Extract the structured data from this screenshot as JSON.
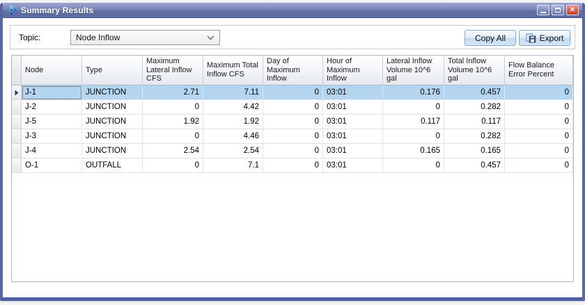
{
  "window": {
    "title": "Summary Results",
    "icons": {
      "app": "node-network-icon",
      "minimize": "–",
      "maximize": "□",
      "close": "✕"
    }
  },
  "toolbar": {
    "topic_label": "Topic:",
    "topic_value": "Node Inflow",
    "copy_all_label": "Copy All",
    "export_label": "Export",
    "icons": {
      "dropdown": "chevron-down",
      "export": "export-save"
    }
  },
  "grid": {
    "columns": [
      {
        "label": "Node",
        "align": "left"
      },
      {
        "label": "Type",
        "align": "left"
      },
      {
        "label": "Maximum Lateral Inflow CFS",
        "align": "right"
      },
      {
        "label": "Maximum Total Inflow CFS",
        "align": "right"
      },
      {
        "label": "Day of Maximum Inflow",
        "align": "right"
      },
      {
        "label": "Hour of Maximum Inflow",
        "align": "left"
      },
      {
        "label": "Lateral Inflow Volume 10^6 gal",
        "align": "right"
      },
      {
        "label": "Total Inflow Volume 10^6 gal",
        "align": "right"
      },
      {
        "label": "Flow Balance Error Percent",
        "align": "right"
      }
    ],
    "rows": [
      [
        "J-1",
        "JUNCTION",
        "2.71",
        "7.11",
        "0",
        "03:01",
        "0.176",
        "0.457",
        "0"
      ],
      [
        "J-2",
        "JUNCTION",
        "0",
        "4.42",
        "0",
        "03:01",
        "0",
        "0.282",
        "0"
      ],
      [
        "J-5",
        "JUNCTION",
        "1.92",
        "1.92",
        "0",
        "03:01",
        "0.117",
        "0.117",
        "0"
      ],
      [
        "J-3",
        "JUNCTION",
        "0",
        "4.46",
        "0",
        "03:01",
        "0",
        "0.282",
        "0"
      ],
      [
        "J-4",
        "JUNCTION",
        "2.54",
        "2.54",
        "0",
        "03:01",
        "0.165",
        "0.165",
        "0"
      ],
      [
        "O-1",
        "OUTFALL",
        "0",
        "7.1",
        "0",
        "03:01",
        "0",
        "0.457",
        "0"
      ]
    ],
    "selected_row_index": 0
  },
  "colors": {
    "titlebar_top": "#9aa5cf",
    "titlebar_bottom": "#5c6ba6",
    "window_border": "#5767a6",
    "close_button": "#dd5741",
    "button_face": "#d4e6f6",
    "button_border": "#87a7cc",
    "selected_row": "#b3d5ef",
    "grid_line": "#dbe5ee",
    "header_gradient_bottom": "#e4e9ef"
  }
}
